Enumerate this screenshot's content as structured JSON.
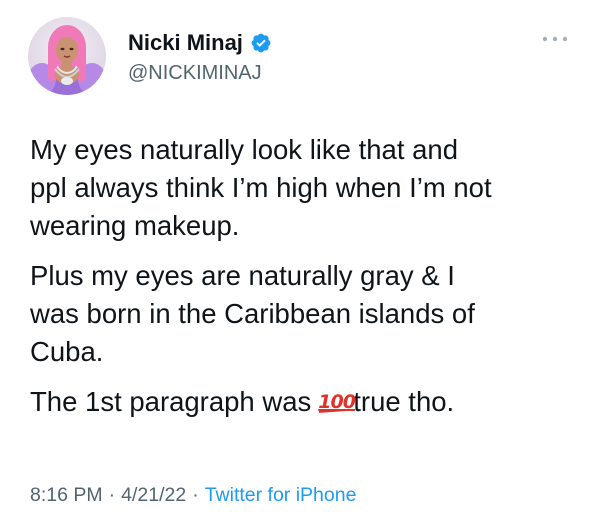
{
  "author": {
    "display_name": "Nicki Minaj",
    "handle": "@NICKIMINAJ",
    "verified_badge_color": "#1d9bf0",
    "avatar_icon": "profile-photo"
  },
  "tweet": {
    "paragraphs": [
      "My eyes naturally look like that and\nppl always think I’m high when I’m not\nwearing makeup.",
      "Plus my eyes are naturally gray & I\nwas born in the Caribbean islands of\nCuba."
    ],
    "last_paragraph": {
      "before_emoji": "The 1st paragraph was",
      "emoji_text": "100",
      "after_emoji": "true tho."
    }
  },
  "meta": {
    "time": "8:16 PM",
    "date": "4/21/22",
    "separator": "·",
    "source": "Twitter for iPhone"
  },
  "icons": {
    "more": "more-options-icon",
    "verified": "verified-badge-icon",
    "emoji": "hundred-points-emoji"
  },
  "colors": {
    "text": "#0f1419",
    "secondary_text": "#536471",
    "link": "#1d9bf0",
    "emoji_red": "#e0322d"
  }
}
